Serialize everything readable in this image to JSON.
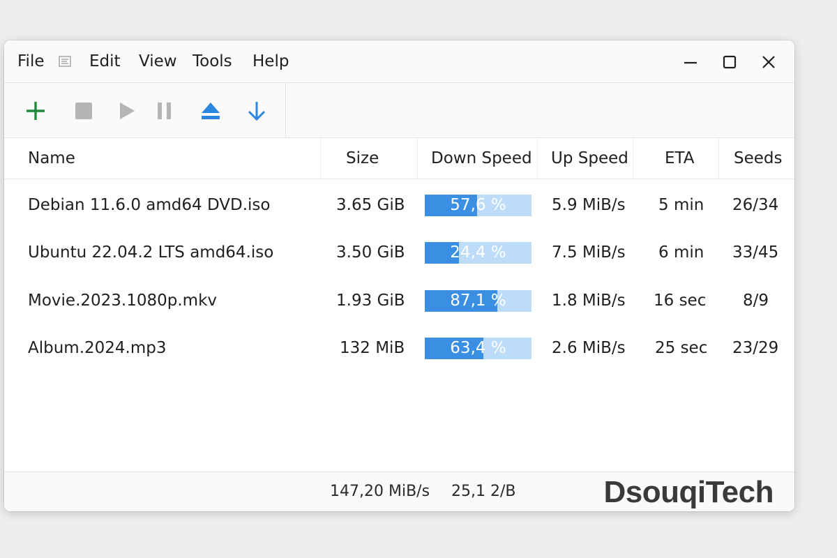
{
  "menu": {
    "items": [
      "File",
      "Edit",
      "View",
      "Tools",
      "Help"
    ]
  },
  "window_controls": [
    "minimize",
    "maximize",
    "close"
  ],
  "toolbar": {
    "buttons": [
      {
        "name": "add-torrent-button",
        "icon": "plus-icon",
        "color": "#1e8a3c"
      },
      {
        "name": "stop-button",
        "icon": "stop-icon",
        "color": "#b5b5b5"
      },
      {
        "name": "start-button",
        "icon": "play-icon",
        "color": "#b5b5b5"
      },
      {
        "name": "pause-button",
        "icon": "pause-icon",
        "color": "#b5b5b5"
      },
      {
        "name": "eject-button",
        "icon": "eject-icon",
        "color": "#2b86e0"
      },
      {
        "name": "download-button",
        "icon": "arrow-down-icon",
        "color": "#2b86e0"
      }
    ]
  },
  "table": {
    "columns": [
      "Name",
      "Size",
      "Down Speed",
      "Up Speed",
      "ETA",
      "Seeds"
    ],
    "rows": [
      {
        "name": "Debian 11.6.0 amd64 DVD.iso",
        "size": "3.65 GiB",
        "progress_text": "57,6 %",
        "progress": 0.49,
        "up_speed": "5.9 MiB/s",
        "eta": "5 min",
        "seeds": "26/34"
      },
      {
        "name": "Ubuntu 22.04.2 LTS amd64.iso",
        "size": "3.50 GiB",
        "progress_text": "24,4 %",
        "progress": 0.32,
        "up_speed": "7.5 MiB/s",
        "eta": "6 min",
        "seeds": "33/45"
      },
      {
        "name": "Movie.2023.1080p.mkv",
        "size": "1.93 GiB",
        "progress_text": "87,1 %",
        "progress": 0.68,
        "up_speed": "1.8 MiB/s",
        "eta": "16 sec",
        "seeds": "8/9"
      },
      {
        "name": "Album.2024.mp3",
        "size": "132 MiB",
        "progress_text": "63,4 %",
        "progress": 0.55,
        "up_speed": "2.6 MiB/s",
        "eta": "25 sec",
        "seeds": "23/29"
      }
    ]
  },
  "status": {
    "down_total": "147,20 MiB/s",
    "up_total": "25,1 2/B"
  },
  "brand": "DsouqiTech",
  "colors": {
    "progress_fill": "#3b8fe3",
    "progress_track": "#bcdcf7",
    "accent_blue": "#2b86e0",
    "accent_green": "#1e8a3c"
  }
}
